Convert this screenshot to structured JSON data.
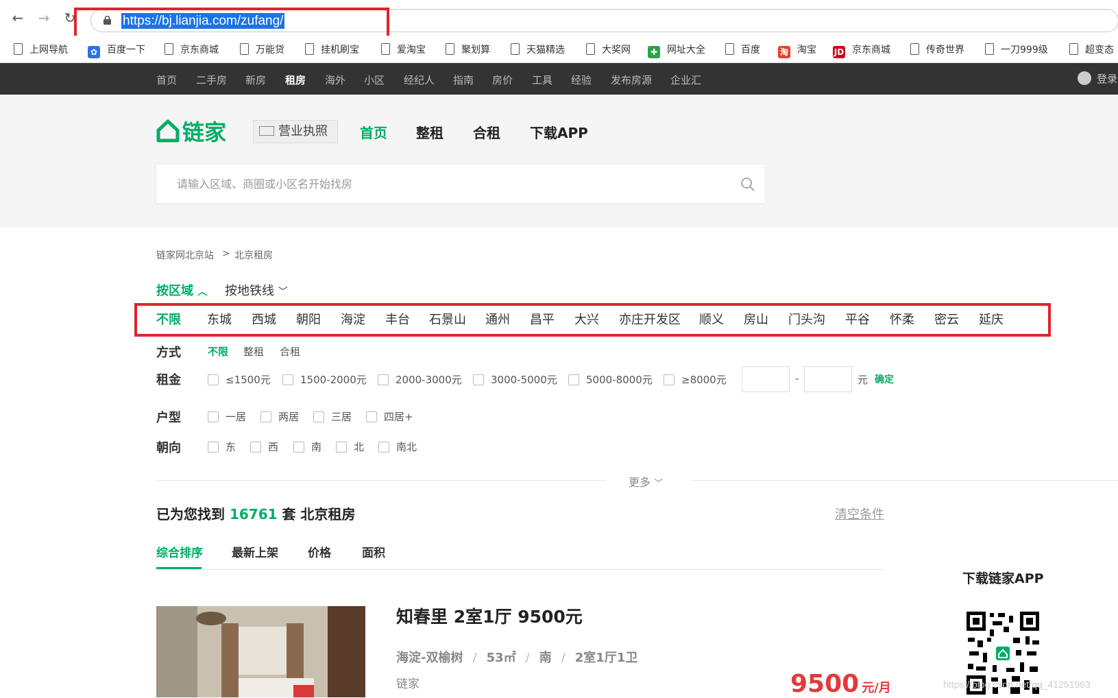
{
  "browser": {
    "url": "https://bj.lianjia.com/zufang/",
    "bookmarks": [
      {
        "label": "上网导航",
        "icon": "page-icon"
      },
      {
        "label": "百度一下",
        "icon": "baidu-paw-icon"
      },
      {
        "label": "京东商城",
        "icon": "page-icon"
      },
      {
        "label": "万能贷",
        "icon": "page-icon"
      },
      {
        "label": "挂机刷宝",
        "icon": "page-icon"
      },
      {
        "label": "爱淘宝",
        "icon": "page-icon"
      },
      {
        "label": "聚划算",
        "icon": "page-icon"
      },
      {
        "label": "天猫精选",
        "icon": "page-icon"
      },
      {
        "label": "大奖网",
        "icon": "page-icon"
      },
      {
        "label": "网址大全",
        "icon": "hao123-icon"
      },
      {
        "label": "百度",
        "icon": "page-icon"
      },
      {
        "label": "淘宝",
        "icon": "taobao-icon"
      },
      {
        "label": "京东商城",
        "icon": "jd-icon"
      },
      {
        "label": "传奇世界",
        "icon": "page-icon"
      },
      {
        "label": "一刀999级",
        "icon": "page-icon"
      },
      {
        "label": "超变态",
        "icon": "page-icon"
      }
    ]
  },
  "topnav": {
    "items": [
      "首页",
      "二手房",
      "新房",
      "租房",
      "海外",
      "小区",
      "经纪人",
      "指南",
      "房价",
      "工具",
      "经验",
      "发布房源",
      "企业汇"
    ],
    "active": "租房",
    "login": "登录"
  },
  "header": {
    "logo": "链家",
    "license": "营业执照",
    "nav": [
      "首页",
      "整租",
      "合租",
      "下载APP"
    ],
    "search_placeholder": "请输入区域、商圈或小区名开始找房"
  },
  "breadcrumb": [
    "链家网北京站",
    ">",
    "北京租房"
  ],
  "filter_tabs": [
    "按区域",
    "按地铁线"
  ],
  "districts": [
    "不限",
    "东城",
    "西城",
    "朝阳",
    "海淀",
    "丰台",
    "石景山",
    "通州",
    "昌平",
    "大兴",
    "亦庄开发区",
    "顺义",
    "房山",
    "门头沟",
    "平谷",
    "怀柔",
    "密云",
    "延庆"
  ],
  "filters": {
    "mode": {
      "label": "方式",
      "options": [
        "不限",
        "整租",
        "合租"
      ]
    },
    "rent": {
      "label": "租金",
      "options": [
        "≤1500元",
        "1500-2000元",
        "2000-3000元",
        "3000-5000元",
        "5000-8000元",
        "≥8000元"
      ],
      "dash": "-",
      "unit": "元",
      "confirm": "确定"
    },
    "layout": {
      "label": "户型",
      "options": [
        "一居",
        "两居",
        "三居",
        "四居+"
      ]
    },
    "orientation": {
      "label": "朝向",
      "options": [
        "东",
        "西",
        "南",
        "北",
        "南北"
      ]
    },
    "more": "更多"
  },
  "result": {
    "prefix": "已为您找到",
    "count": "16761",
    "suffix": "套 北京租房",
    "clear": "清空条件"
  },
  "sort_tabs": [
    "综合排序",
    "最新上架",
    "价格",
    "面积"
  ],
  "listing": {
    "title": "知春里 2室1厅 9500元",
    "meta": [
      "海淀-双榆树",
      "53㎡",
      "南",
      "2室1厅1卫"
    ],
    "brand": "链家",
    "price": "9500",
    "price_unit": "元/月"
  },
  "sidebar": {
    "app_title": "下载链家APP"
  },
  "watermark": "https://blog.csdn.net/qq_41251963",
  "colors": {
    "accent": "#00ae66",
    "topnav_bg": "#333333",
    "highlight_box": "#e0242e",
    "price": "#e4393c"
  }
}
